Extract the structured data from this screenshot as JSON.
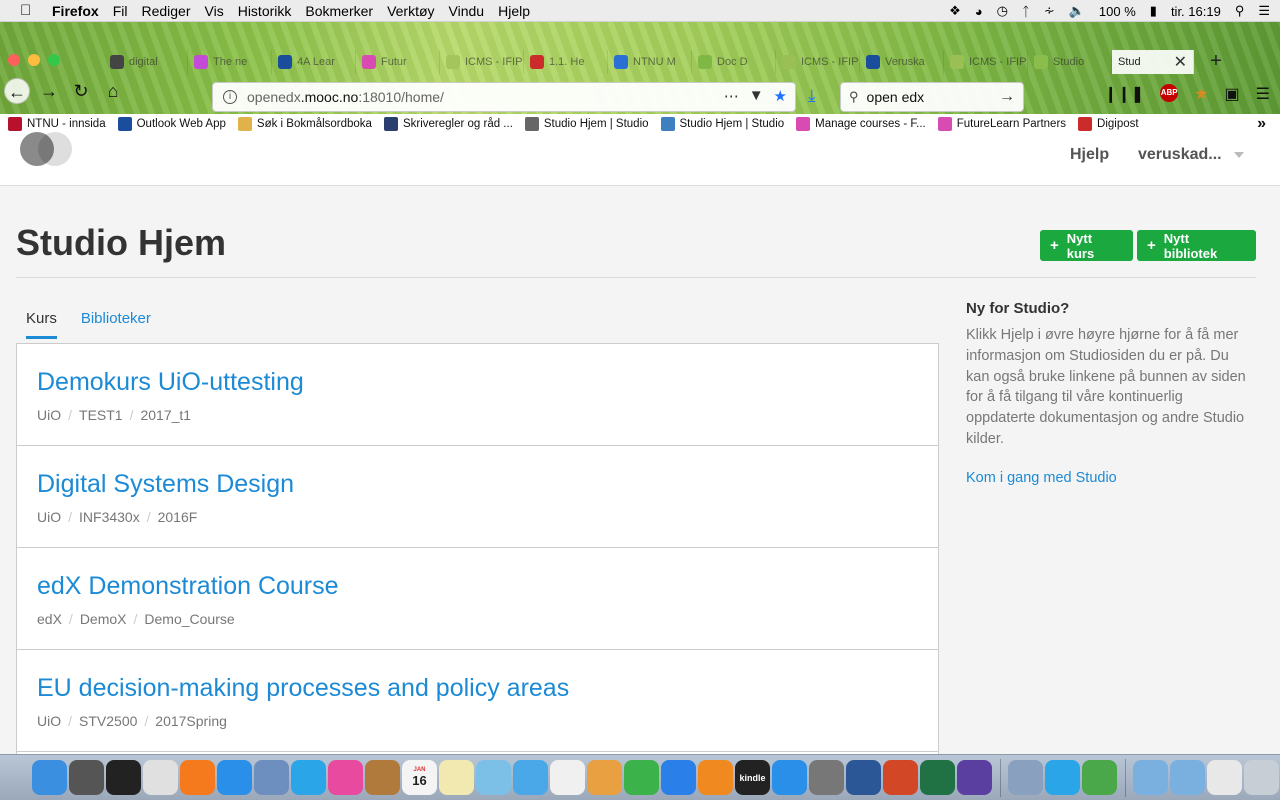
{
  "menubar": {
    "app": "Firefox",
    "items": [
      "Fil",
      "Rediger",
      "Vis",
      "Historikk",
      "Bokmerker",
      "Verktøy",
      "Vindu",
      "Hjelp"
    ],
    "battery": "100 %",
    "clock": "tir. 16:19"
  },
  "browser": {
    "tabs": [
      {
        "label": "digital",
        "color": "#444"
      },
      {
        "label": "The ne",
        "color": "#c44bd8"
      },
      {
        "label": "4A Lear",
        "color": "#1a4e9c"
      },
      {
        "label": "Futur",
        "color": "#d84bb3"
      },
      {
        "label": "ICMS - IFIP",
        "color": "#a4c45c"
      },
      {
        "label": "1.1. He",
        "color": "#cc2b2b"
      },
      {
        "label": "NTNU M",
        "color": "#2a6fd4"
      },
      {
        "label": "Doc D",
        "color": "#7fb845"
      },
      {
        "label": "ICMS - IFIP",
        "color": "#9abf55"
      },
      {
        "label": "Veruska",
        "color": "#1a4e9c"
      },
      {
        "label": "ICMS - IFIP",
        "color": "#9abf55"
      },
      {
        "label": "Studio",
        "color": "#8bbd4d"
      }
    ],
    "active_tab": "Stud",
    "url_prefix": "openedx",
    "url_domain": ".mooc.no",
    "url_rest": ":18010/home/",
    "search_value": "open edx",
    "bookmarks": [
      {
        "label": "NTNU - innsida",
        "color": "#b8112d"
      },
      {
        "label": "Outlook Web App",
        "color": "#1a4e9c"
      },
      {
        "label": "Søk i Bokmålsordboka",
        "color": "#e2b24a"
      },
      {
        "label": "Skriveregler og råd ...",
        "color": "#2a3f6d"
      },
      {
        "label": "Studio Hjem | Studio",
        "color": "#666"
      },
      {
        "label": "Studio Hjem | Studio",
        "color": "#3d7fbf"
      },
      {
        "label": "Manage courses - F...",
        "color": "#d84bb3"
      },
      {
        "label": "FutureLearn Partners",
        "color": "#d84bb3"
      },
      {
        "label": "Digipost",
        "color": "#cc2b2b"
      }
    ]
  },
  "header": {
    "help": "Hjelp",
    "user": "veruskad..."
  },
  "page": {
    "title": "Studio Hjem",
    "new_course": "Nytt kurs",
    "new_library": "Nytt bibliotek",
    "tabs": [
      "Kurs",
      "Biblioteker"
    ]
  },
  "courses": [
    {
      "title": "Demokurs UiO-uttesting",
      "org": "UiO",
      "number": "TEST1",
      "run": "2017_t1"
    },
    {
      "title": "Digital Systems Design",
      "org": "UiO",
      "number": "INF3430x",
      "run": "2016F"
    },
    {
      "title": "edX Demonstration Course",
      "org": "edX",
      "number": "DemoX",
      "run": "Demo_Course"
    },
    {
      "title": "EU decision-making processes and policy areas",
      "org": "UiO",
      "number": "STV2500",
      "run": "2017Spring"
    }
  ],
  "sidebar": {
    "heading": "Ny for Studio?",
    "text": "Klikk Hjelp i øvre høyre hjørne for å få mer informasjon om Studiosiden du er på. Du kan også bruke linkene på bunnen av siden for å få tilgang til våre kontinuerlig oppdaterte dokumentasjon og andre Studio kilder.",
    "link": "Kom i gang med Studio"
  },
  "dock": {
    "calendar_month": "JAN",
    "calendar_day": "16",
    "kindle_label": "kindle",
    "apps": [
      {
        "name": "finder",
        "color": "#3b8fe0"
      },
      {
        "name": "launchpad",
        "color": "#555"
      },
      {
        "name": "dashboard",
        "color": "#222"
      },
      {
        "name": "chrome",
        "color": "#e0e0e0"
      },
      {
        "name": "firefox",
        "color": "#f57a1e"
      },
      {
        "name": "safari",
        "color": "#2a8fe8"
      },
      {
        "name": "preview",
        "color": "#6c8fbf"
      },
      {
        "name": "skype",
        "color": "#2aa6e8"
      },
      {
        "name": "itunes",
        "color": "#e84aa0"
      },
      {
        "name": "notes-book",
        "color": "#b07a3c"
      },
      {
        "name": "calendar",
        "color": "#f4f4f4"
      },
      {
        "name": "stickies",
        "color": "#f1e9b0"
      },
      {
        "name": "photos-maps",
        "color": "#7cc0e8"
      },
      {
        "name": "messages",
        "color": "#4aa8e8"
      },
      {
        "name": "photos",
        "color": "#f0f0f0"
      },
      {
        "name": "keynote-pages",
        "color": "#e8a040"
      },
      {
        "name": "numbers",
        "color": "#3cb24a"
      },
      {
        "name": "keynote",
        "color": "#2a7fe8"
      },
      {
        "name": "ibooks",
        "color": "#f08a20"
      },
      {
        "name": "kindle",
        "color": "#222"
      },
      {
        "name": "app-store",
        "color": "#2a8fe8"
      },
      {
        "name": "system-preferences",
        "color": "#777"
      },
      {
        "name": "word",
        "color": "#2b5797"
      },
      {
        "name": "powerpoint",
        "color": "#d24726"
      },
      {
        "name": "excel",
        "color": "#207245"
      },
      {
        "name": "pricing-p",
        "color": "#5a3fa0"
      },
      {
        "name": "preview-2",
        "color": "#8aa0bf"
      },
      {
        "name": "skype-2",
        "color": "#2aa6e8"
      },
      {
        "name": "globe",
        "color": "#4aa84a"
      }
    ]
  }
}
